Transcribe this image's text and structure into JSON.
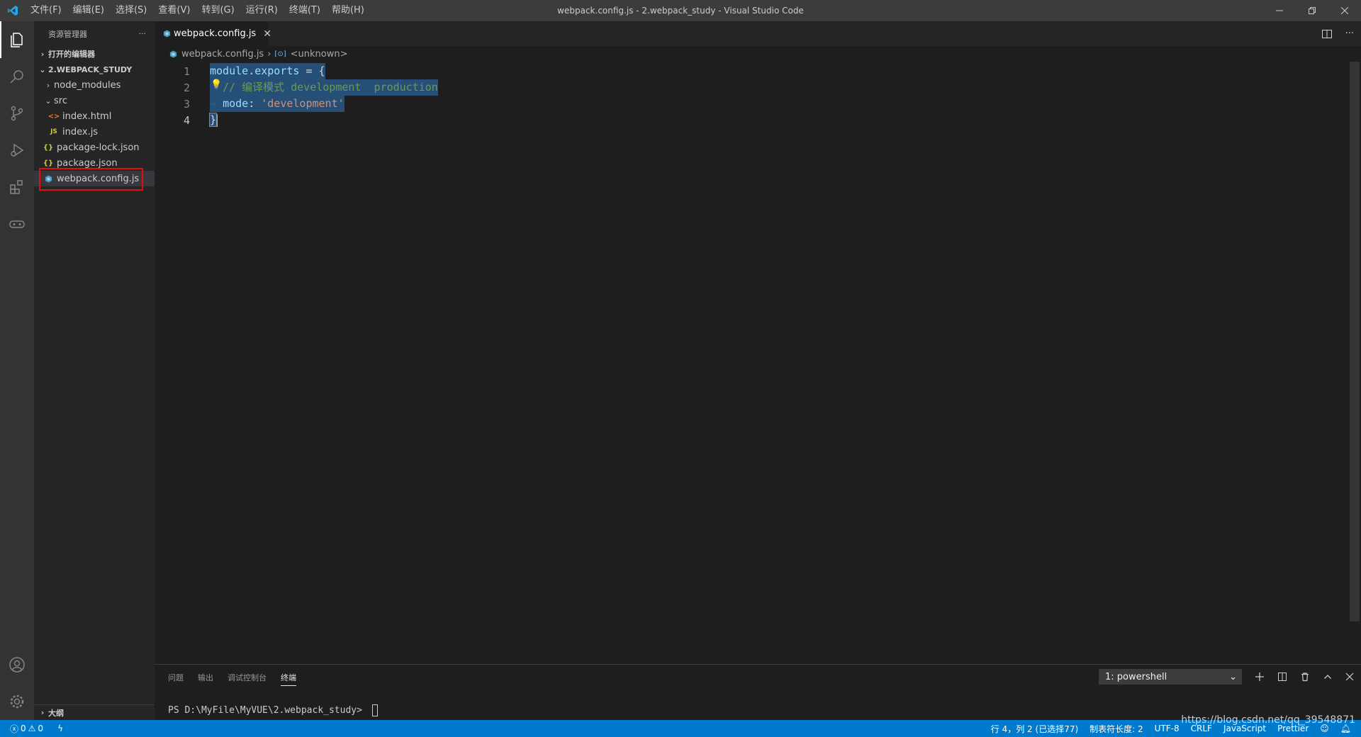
{
  "window": {
    "title": "webpack.config.js - 2.webpack_study - Visual Studio Code",
    "menu": [
      "文件(F)",
      "编辑(E)",
      "选择(S)",
      "查看(V)",
      "转到(G)",
      "运行(R)",
      "终端(T)",
      "帮助(H)"
    ]
  },
  "sidebar": {
    "header": "资源管理器",
    "more": "···",
    "open_editors": "打开的编辑器",
    "workspace": "2.WEBPACK_STUDY",
    "tree": {
      "node_modules": "node_modules",
      "src": "src",
      "index_html": "index.html",
      "index_js": "index.js",
      "package_lock": "package-lock.json",
      "package_json": "package.json",
      "webpack_config": "webpack.config.js"
    },
    "icons": {
      "js_badge": "JS",
      "json_badge": "{}",
      "html_badge": "<>"
    },
    "outline": "大纲"
  },
  "editor": {
    "tab_label": "webpack.config.js",
    "breadcrumb": {
      "file": "webpack.config.js",
      "symbol": "<unknown>"
    },
    "lines": {
      "n1": "1",
      "n2": "2",
      "n3": "3",
      "n4": "4",
      "l1_a": "module",
      "l1_b": ".",
      "l1_c": "exports",
      "l1_d": " = {",
      "l2_comment": "// 编译模式 development  production",
      "l3_indent": "→ ",
      "l3_key": "mode",
      "l3_colon": ": ",
      "l3_value": "'development'",
      "l4": "}"
    }
  },
  "panel": {
    "tabs": [
      "问题",
      "输出",
      "调试控制台",
      "终端"
    ],
    "terminal_select": "1: powershell",
    "prompt": "PS D:\\MyFile\\MyVUE\\2.webpack_study> "
  },
  "status": {
    "errors": "0",
    "warnings": "0",
    "position": "行 4，列 2 (已选择77)",
    "tab_size": "制表符长度: 2",
    "encoding": "UTF-8",
    "eol": "CRLF",
    "language": "JavaScript",
    "formatter": "Prettier"
  },
  "watermark": "https://blog.csdn.net/qq_39548871",
  "colors": {
    "accent": "#007acc",
    "highlight_box": "#e01010",
    "selection": "#264f78"
  }
}
